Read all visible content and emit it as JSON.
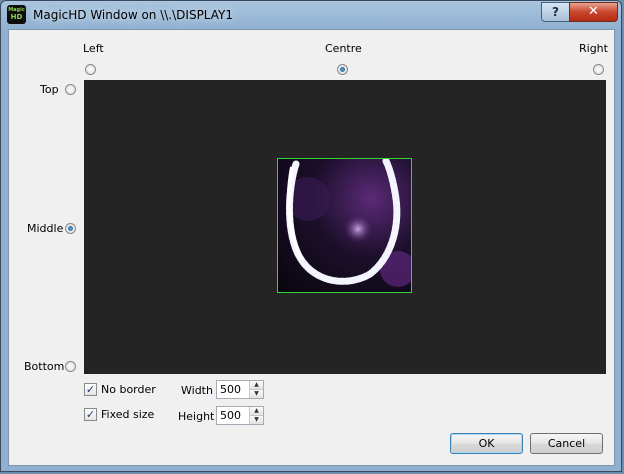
{
  "window": {
    "title": "MagicHD Window on \\\\.\\DISPLAY1",
    "app_icon_top": "Magic",
    "app_icon_bottom": "HD",
    "help_button": "?",
    "close_button": "✕"
  },
  "horizontal_alignment": {
    "options": [
      "Left",
      "Centre",
      "Right"
    ],
    "selected": "Centre"
  },
  "vertical_alignment": {
    "options": [
      "Top",
      "Middle",
      "Bottom"
    ],
    "selected": "Middle"
  },
  "preview": {
    "background_color": "#242424",
    "frame_border_color": "#33d633"
  },
  "options": {
    "no_border_label": "No border",
    "no_border_checked": true,
    "fixed_size_label": "Fixed size",
    "fixed_size_checked": true
  },
  "size": {
    "width_label": "Width",
    "width_value": "500",
    "height_label": "Height",
    "height_value": "500"
  },
  "buttons": {
    "ok": "OK",
    "cancel": "Cancel"
  },
  "colors": {
    "accent": "#3c7fb1",
    "title_bar": "#8fb0d0"
  }
}
